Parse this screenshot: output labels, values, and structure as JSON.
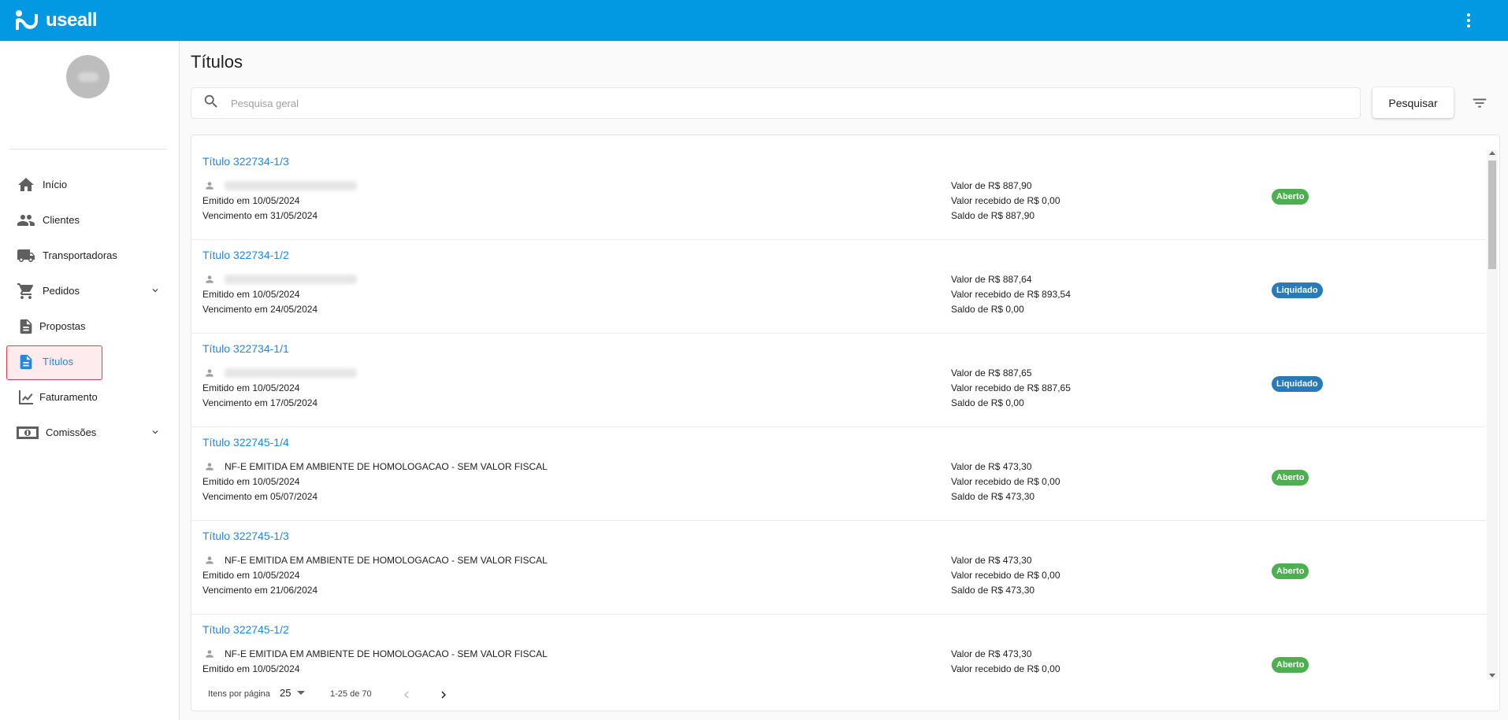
{
  "app": {
    "brand": "useall"
  },
  "page": {
    "title": "Títulos"
  },
  "search": {
    "placeholder": "Pesquisa geral",
    "value": "",
    "button": "Pesquisar"
  },
  "sidebar": {
    "items": [
      {
        "label": "Início",
        "icon": "home-icon",
        "active": false,
        "expandable": false
      },
      {
        "label": "Clientes",
        "icon": "people-icon",
        "active": false,
        "expandable": false
      },
      {
        "label": "Transportadoras",
        "icon": "truck-icon",
        "active": false,
        "expandable": false
      },
      {
        "label": "Pedidos",
        "icon": "cart-icon",
        "active": false,
        "expandable": true
      },
      {
        "label": "Propostas",
        "icon": "proposal-icon",
        "active": false,
        "expandable": false
      },
      {
        "label": "Títulos",
        "icon": "document-icon",
        "active": true,
        "expandable": false
      },
      {
        "label": "Faturamento",
        "icon": "chart-icon",
        "active": false,
        "expandable": false
      },
      {
        "label": "Comissões",
        "icon": "money-icon",
        "active": false,
        "expandable": true
      }
    ]
  },
  "titulos": [
    {
      "title": "Título 322734-1/3",
      "client": "",
      "client_blurred": true,
      "emitido": "Emitido em 10/05/2024",
      "vencimento": "Vencimento em 31/05/2024",
      "valor": "Valor de R$ 887,90",
      "recebido": "Valor recebido de R$ 0,00",
      "saldo": "Saldo de R$ 887,90",
      "status": "Aberto"
    },
    {
      "title": "Título 322734-1/2",
      "client": "",
      "client_blurred": true,
      "emitido": "Emitido em 10/05/2024",
      "vencimento": "Vencimento em 24/05/2024",
      "valor": "Valor de R$ 887,64",
      "recebido": "Valor recebido de R$ 893,54",
      "saldo": "Saldo de R$ 0,00",
      "status": "Liquidado"
    },
    {
      "title": "Título 322734-1/1",
      "client": "",
      "client_blurred": true,
      "emitido": "Emitido em 10/05/2024",
      "vencimento": "Vencimento em 17/05/2024",
      "valor": "Valor de R$ 887,65",
      "recebido": "Valor recebido de R$ 887,65",
      "saldo": "Saldo de R$ 0,00",
      "status": "Liquidado"
    },
    {
      "title": "Título 322745-1/4",
      "client": "NF-E EMITIDA EM AMBIENTE DE HOMOLOGACAO - SEM VALOR FISCAL",
      "client_blurred": false,
      "emitido": "Emitido em 10/05/2024",
      "vencimento": "Vencimento em 05/07/2024",
      "valor": "Valor de R$ 473,30",
      "recebido": "Valor recebido de R$ 0,00",
      "saldo": "Saldo de R$ 473,30",
      "status": "Aberto"
    },
    {
      "title": "Título 322745-1/3",
      "client": "NF-E EMITIDA EM AMBIENTE DE HOMOLOGACAO - SEM VALOR FISCAL",
      "client_blurred": false,
      "emitido": "Emitido em 10/05/2024",
      "vencimento": "Vencimento em 21/06/2024",
      "valor": "Valor de R$ 473,30",
      "recebido": "Valor recebido de R$ 0,00",
      "saldo": "Saldo de R$ 473,30",
      "status": "Aberto"
    },
    {
      "title": "Título 322745-1/2",
      "client": "NF-E EMITIDA EM AMBIENTE DE HOMOLOGACAO - SEM VALOR FISCAL",
      "client_blurred": false,
      "emitido": "Emitido em 10/05/2024",
      "vencimento": "",
      "valor": "Valor de R$ 473,30",
      "recebido": "Valor recebido de R$ 0,00",
      "saldo": "",
      "status": "Aberto"
    }
  ],
  "pager": {
    "items_per_page_label": "Itens por página",
    "page_size": "25",
    "range": "1-25 de 70"
  },
  "colors": {
    "topbar": "#0398e2",
    "link": "#1e88e5",
    "aberto": "#4caf50",
    "liquidado": "#2a7ab8",
    "active_highlight": "#e53950"
  }
}
